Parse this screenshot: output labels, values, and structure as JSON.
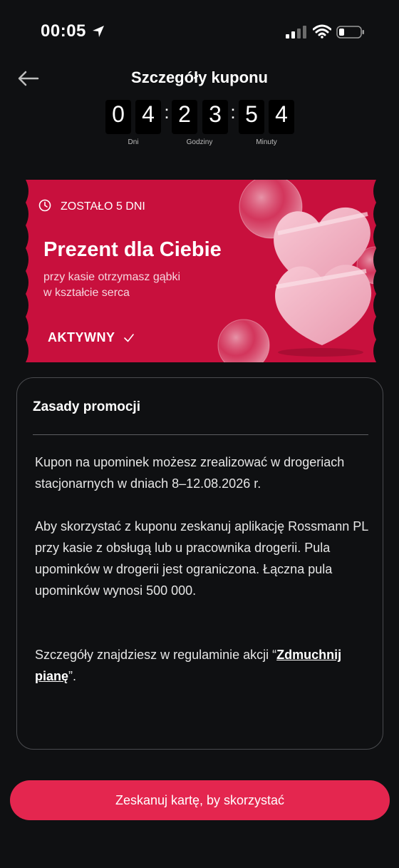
{
  "status_bar": {
    "time": "00:05"
  },
  "header": {
    "title": "Szczegóły kuponu"
  },
  "countdown": {
    "digits": [
      "0",
      "4",
      "2",
      "3",
      "5",
      "4"
    ],
    "labels": {
      "days": "Dni",
      "hours": "Godziny",
      "minutes": "Minuty"
    }
  },
  "coupon": {
    "days_left": "ZOSTAŁO 5 DNI",
    "title": "Prezent dla Ciebie",
    "subtitle_line1": "przy kasie otrzymasz gąbki",
    "subtitle_line2": "w kształcie serca",
    "status": "AKTYWNY",
    "colors": {
      "background": "#c8103d",
      "heart": "#f3b9c8"
    }
  },
  "rules": {
    "title": "Zasady promocji",
    "paragraph1": "Kupon na upominek możesz zrealizować w drogeriach stacjonarnych w dniach 8–12.08.2026 r.",
    "paragraph2": "Aby skorzystać z kuponu zeskanuj aplikację Rossmann PL przy kasie z obsługą lub u pracownika drogerii. Pula upominków w drogerii jest ograniczona. Łączna pula upominków wynosi 500 000.",
    "paragraph3_prefix": "Szczegóły znajdziesz w regulaminie akcji “",
    "paragraph3_link": "Zdmuchnij pianę",
    "paragraph3_suffix": "”."
  },
  "action": {
    "scan_label": "Zeskanuj kartę, by skorzystać",
    "color": "#e4264f"
  }
}
